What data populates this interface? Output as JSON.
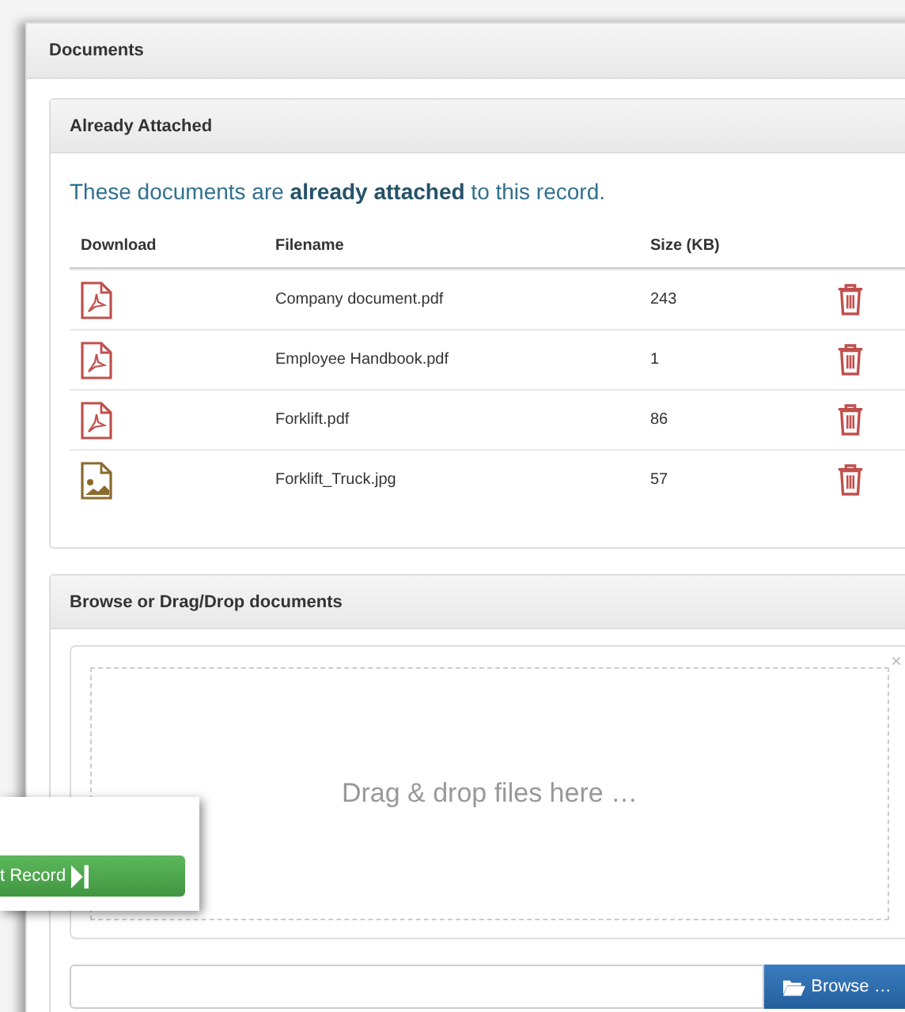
{
  "panel": {
    "title": "Documents"
  },
  "attached": {
    "title": "Already Attached",
    "intro": "These documents are **already attached** to this record.",
    "columns": [
      "Download",
      "Filename",
      "Size (KB)"
    ],
    "rows": [
      {
        "kind": "pdf",
        "filename": "Company document.pdf",
        "size": "243"
      },
      {
        "kind": "pdf",
        "filename": "Employee Handbook.pdf",
        "size": "1"
      },
      {
        "kind": "pdf",
        "filename": "Forklift.pdf",
        "size": "86"
      },
      {
        "kind": "image",
        "filename": "Forklift_Truck.jpg",
        "size": "57"
      }
    ]
  },
  "upload": {
    "title": "Browse or Drag/Drop documents",
    "close": "×",
    "drop_hint": "Drag & drop files here …",
    "browse": "Browse …"
  },
  "popup": {
    "button": "t Record"
  }
}
